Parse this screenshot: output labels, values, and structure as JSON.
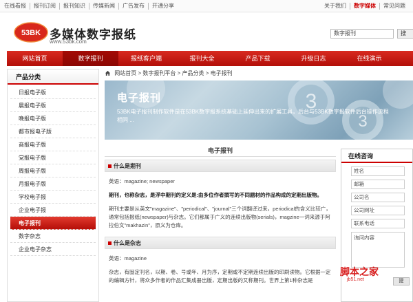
{
  "topbar": {
    "left_links": [
      "在线看报",
      "报刊订阅",
      "报刊知识",
      "传媒新闻",
      "广告发布",
      "开通分享"
    ],
    "right_links": [
      "关于我们",
      "数字媒体",
      "常见问题"
    ]
  },
  "header": {
    "logo_mark": "53BK",
    "logo_text": "多媒体数字报纸",
    "logo_url": "www.53bk.com",
    "search_placeholder": "数字报刊",
    "search_button": "搜"
  },
  "nav": {
    "items": [
      "网站首页",
      "数字报刊",
      "报纸客户端",
      "报刊大全",
      "产品下载",
      "升级日志",
      "在线演示"
    ],
    "active_index": 1
  },
  "sidebar": {
    "title": "产品分类",
    "items": [
      "日报电子版",
      "晨报电子版",
      "晚报电子版",
      "都市报电子版",
      "商报电子版",
      "党报电子版",
      "周报电子版",
      "月报电子版",
      "学校电子报",
      "企业电子报",
      "电子报刊",
      "数字杂志",
      "企业电子杂志"
    ],
    "active_index": 10
  },
  "breadcrumb": {
    "items": [
      "网站首页",
      "数字报刊平台",
      "产品分类",
      "电子报刊"
    ],
    "separator": ">"
  },
  "banner": {
    "title": "电子报刊",
    "description": "53BK电子报刊制作软件是在53BK数字报系统基础上延伸出来的扩展工具，后台与53BK数字报软件后台操作流程相同 ..."
  },
  "content": {
    "title": "电子报刊",
    "sections": [
      {
        "heading": "什么是期刊",
        "paragraphs": [
          "英语：magazine; newspaper",
          "期刊，也称杂志，是浮中期刊的定义是:由多位作者撰写的不同题材的作品构成的定期出版物。",
          "期刊主要是从英文\"magazine\"、\"periodical\"、\"journal\"三个词翻译过来，periodical的含义比较广，通常包括报纸(newspaper)与杂志。它们都属于广义的连续出版物(serials)，magzine一词来源于阿拉伯文\"makhazin\"，原义为仓库。"
        ]
      },
      {
        "heading": "什么是杂志",
        "paragraphs": [
          "英语：magazine",
          "杂志，有固定刊名，以期、卷、号或年、月为序，定期或不定期连续出版的印刷读物。它根据一定的编辑方针，将众多作者的作品汇集成册出版，定期出版的又称期刊。世界上第1种杂志是"
        ]
      }
    ]
  },
  "consult": {
    "title": "在线咨询",
    "fields": [
      "姓名",
      "邮箱",
      "公司名",
      "公司网址",
      "联系电话"
    ],
    "message_placeholder": "询问内容",
    "submit_label": "提"
  },
  "watermark": {
    "text": "脚本之家",
    "url": "jb51.net"
  },
  "colors": {
    "brand_red": "#c00000",
    "nav_red": "#c8180f"
  }
}
